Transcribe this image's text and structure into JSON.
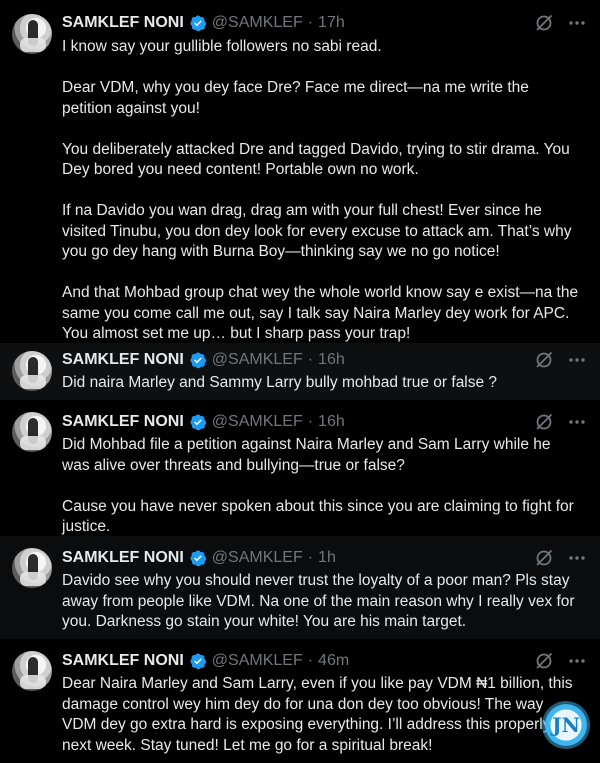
{
  "author": {
    "name": "SAMKLEF NONI",
    "handle": "@SAMKLEF"
  },
  "separator": "·",
  "tweets": [
    {
      "time": "17h",
      "paragraphs": [
        "I know say your gullible followers no sabi read.",
        "Dear VDM, why you dey face Dre? Face me direct—na me write the petition against you!",
        "You deliberately attacked Dre and tagged Davido, trying to stir drama. You Dey bored you need content! Portable own no work.",
        "If na Davido you wan drag, drag am with your full chest! Ever since he visited Tinubu, you don dey look for every excuse to attack am. That’s why you go dey hang with Burna Boy—thinking say we no go notice!",
        "And that Mohbad group chat wey the whole world know say e exist—na the same you come call me out, say I talk say Naira Marley dey work for APC. You almost set me up… but I sharp pass your trap!"
      ]
    },
    {
      "time": "16h",
      "paragraphs": [
        "Did naira Marley and Sammy Larry bully mohbad true or false ?"
      ]
    },
    {
      "time": "16h",
      "paragraphs": [
        "Did Mohbad file a petition against Naira Marley and Sam Larry while he was alive over threats and bullying—true or false?",
        "Cause you have never spoken about this since you are claiming to fight for justice."
      ]
    },
    {
      "time": "1h",
      "paragraphs": [
        "Davido see why you should never trust the loyalty of a poor man?  Pls stay away from people like VDM. Na one of the main reason why I really vex for you. Darkness go stain your white!  You are his main target."
      ]
    },
    {
      "time": "46m",
      "paragraphs": [
        "Dear Naira Marley and Sam Larry, even if you like pay VDM ₦1 billion, this damage control wey him dey do for una don dey too obvious! The way VDM dey go extra hard is exposing everything. I’ll address this properly next week. Stay tuned!  Let me go for a spiritual break!"
      ]
    }
  ],
  "icons": {
    "verified": "verified-badge-icon",
    "grok": "grok-icon",
    "more": "more-icon"
  },
  "colors": {
    "background": "#000000",
    "text": "#e7e9ea",
    "muted": "#71767b",
    "verified": "#1d9bf0"
  },
  "watermark": {
    "text": "JN"
  }
}
